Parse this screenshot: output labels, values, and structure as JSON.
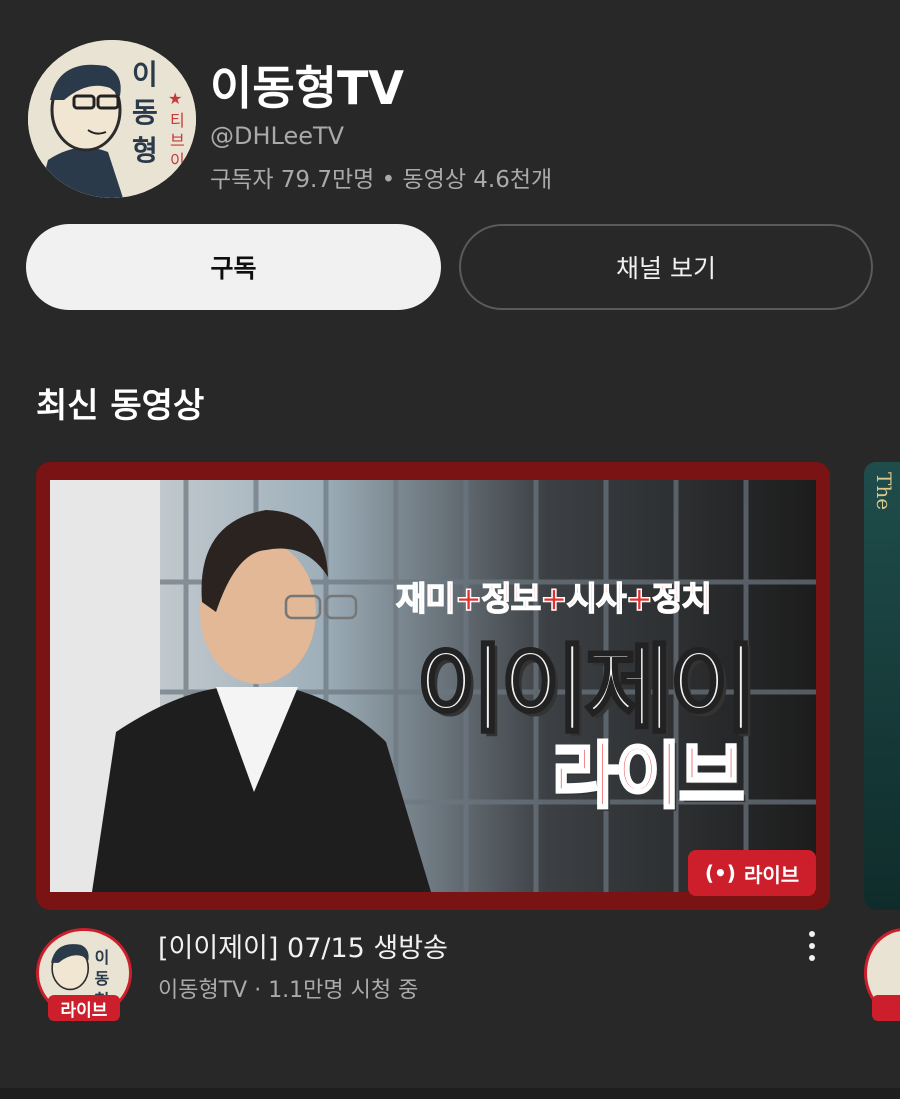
{
  "channel": {
    "name": "이동형TV",
    "handle": "@DHLeeTV",
    "stats": "구독자 79.7만명 • 동영상 4.6천개",
    "avatar_icon": "caricature-avatar-icon"
  },
  "actions": {
    "subscribe_label": "구독",
    "view_channel_label": "채널 보기"
  },
  "section": {
    "title": "최신 동영상"
  },
  "video": {
    "thumbnail_line1": "재미+정보+시사+정치",
    "thumbnail_line2": "이이제이",
    "thumbnail_line3": "라이브",
    "live_badge": "라이브",
    "avatar_live_badge": "라이브",
    "title": "[이이제이] 07/15 생방송",
    "meta": "이동형TV · 1.1만명 시청 중"
  },
  "next_card": {
    "text": "The"
  },
  "colors": {
    "background": "#282828",
    "accent_red": "#cc1f2b",
    "thumb_border": "#7a1414"
  }
}
